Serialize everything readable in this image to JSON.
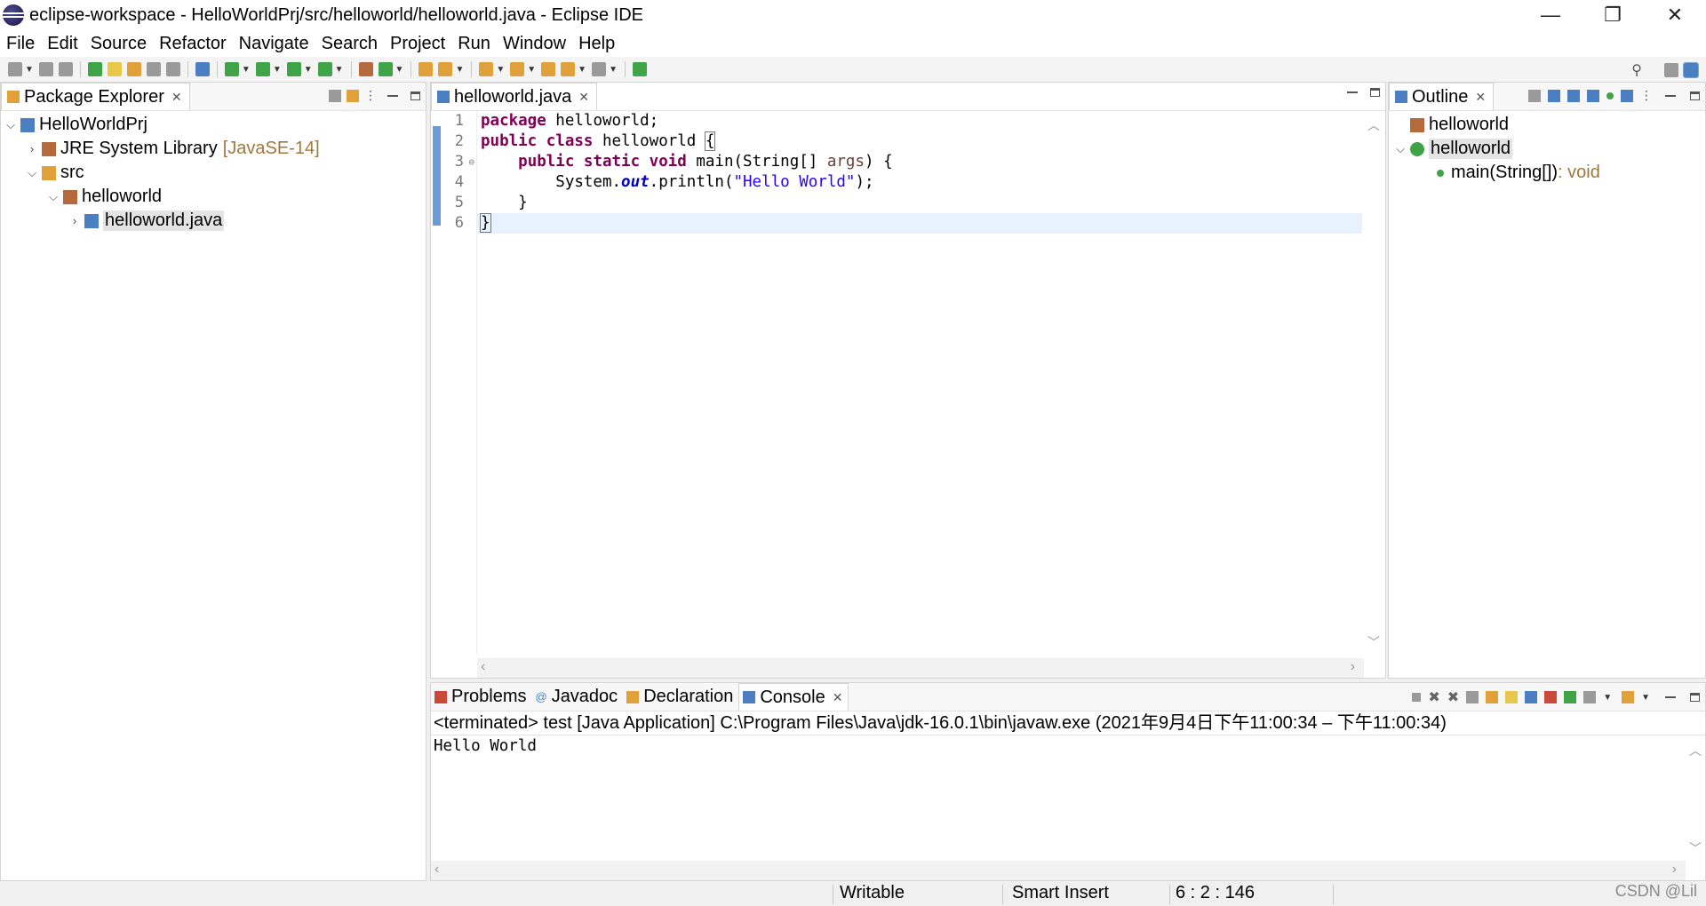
{
  "window": {
    "title": "eclipse-workspace - HelloWorldPrj/src/helloworld/helloworld.java - Eclipse IDE",
    "minimize": "—",
    "restore": "❐",
    "close": "✕"
  },
  "menu": [
    "File",
    "Edit",
    "Source",
    "Refactor",
    "Navigate",
    "Search",
    "Project",
    "Run",
    "Window",
    "Help"
  ],
  "package_explorer": {
    "tab_label": "Package Explorer",
    "tree": [
      {
        "label": "HelloWorldPrj",
        "icon": "project-icon",
        "expanded": true,
        "level": 0
      },
      {
        "label": "JRE System Library",
        "decoration": "[JavaSE-14]",
        "icon": "library-icon",
        "expanded": false,
        "level": 1
      },
      {
        "label": "src",
        "icon": "source-folder-icon",
        "expanded": true,
        "level": 1
      },
      {
        "label": "helloworld",
        "icon": "package-icon",
        "expanded": true,
        "level": 2
      },
      {
        "label": "helloworld.java",
        "icon": "java-file-icon",
        "expanded": false,
        "level": 3,
        "selected": true
      }
    ]
  },
  "editor": {
    "tab_label": "helloworld.java",
    "line_numbers": [
      "1",
      "2",
      "3",
      "4",
      "5",
      "6"
    ],
    "code": {
      "l1_kw": "package",
      "l1_rest": " helloworld;",
      "l2_kw": "public class",
      "l2_rest": " helloworld ",
      "l2_brace": "{",
      "l3_indent": "    ",
      "l3_kw": "public static void",
      "l3_rest": " main(String[] ",
      "l3_param": "args",
      "l3_end": ") {",
      "l4_pre": "        System.",
      "l4_field": "out",
      "l4_mid": ".println(",
      "l4_str": "\"Hello World\"",
      "l4_end": ");",
      "l5": "    }",
      "l6": "}"
    }
  },
  "outline": {
    "tab_label": "Outline",
    "items": [
      {
        "label": "helloworld",
        "icon": "package-decl-icon"
      },
      {
        "label": "helloworld",
        "icon": "class-icon",
        "selected": true
      },
      {
        "label": "main(String[])",
        "type": " : void",
        "icon": "public-static-method-icon"
      }
    ]
  },
  "bottom_tabs": {
    "problems": "Problems",
    "javadoc": "Javadoc",
    "declaration": "Declaration",
    "console": "Console"
  },
  "console": {
    "header": "<terminated> test [Java Application] C:\\Program Files\\Java\\jdk-16.0.1\\bin\\javaw.exe  (2021年9月4日下午11:00:34 – 下午11:00:34)",
    "output": "Hello World"
  },
  "statusbar": {
    "writable": "Writable",
    "insert_mode": "Smart Insert",
    "position": "6 : 2 : 146",
    "watermark": "CSDN @Lil"
  },
  "colors": {
    "keyword": "#7f0055",
    "string": "#2a00ff",
    "static_field": "#0000c0",
    "current_line": "#e8f2fe",
    "decoration": "#a0783c"
  }
}
